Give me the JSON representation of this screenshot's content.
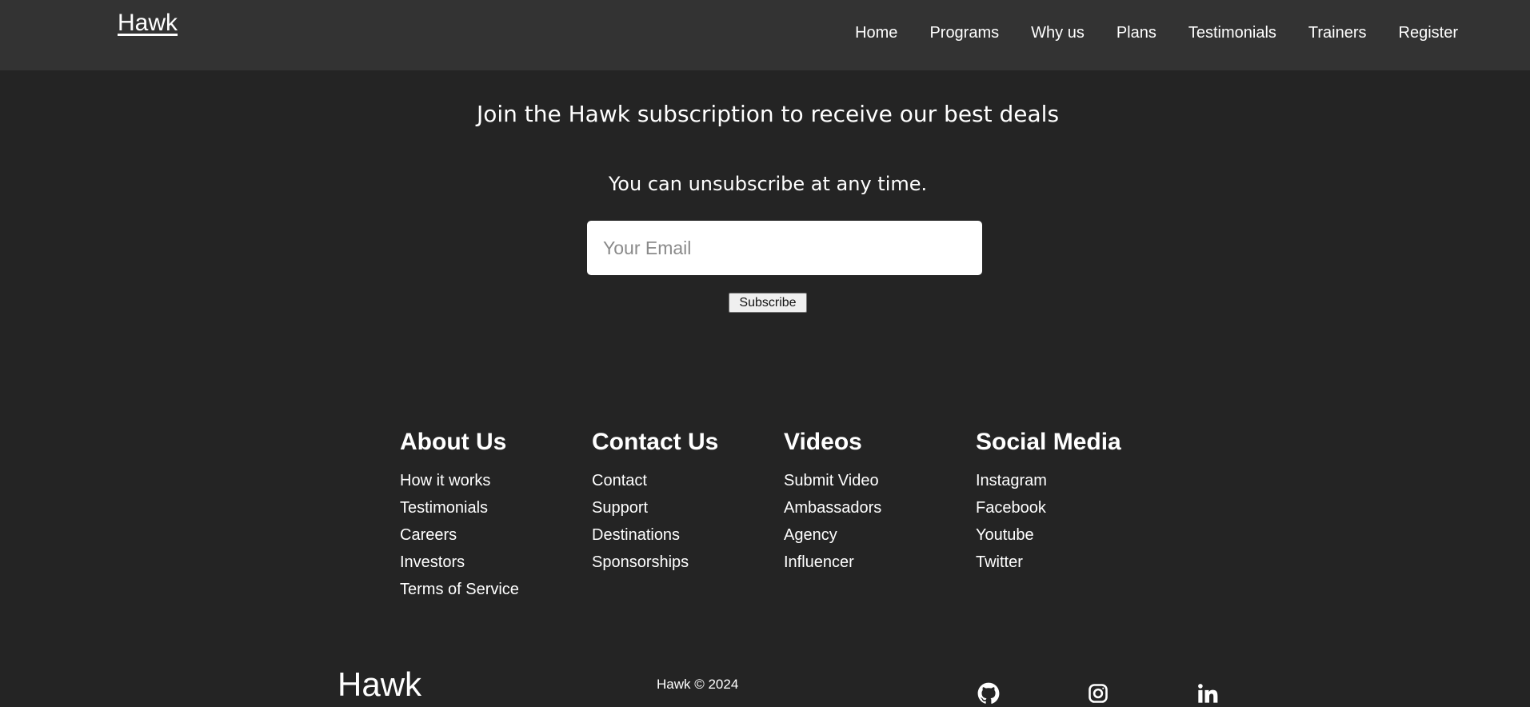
{
  "header": {
    "brand": "Hawk",
    "nav": [
      "Home",
      "Programs",
      "Why us",
      "Plans",
      "Testimonials",
      "Trainers",
      "Register"
    ]
  },
  "subscribe": {
    "heading": "Join the Hawk subscription to receive our best deals",
    "subtext": "You can unsubscribe at any time.",
    "email_placeholder": "Your Email",
    "email_value": "",
    "button_label": "Subscribe"
  },
  "footer": {
    "columns": [
      {
        "title": "About Us",
        "links": [
          "How it works",
          "Testimonials",
          "Careers",
          "Investors",
          "Terms of Service"
        ]
      },
      {
        "title": "Contact Us",
        "links": [
          "Contact",
          "Support",
          "Destinations",
          "Sponsorships"
        ]
      },
      {
        "title": "Videos",
        "links": [
          "Submit Video",
          "Ambassadors",
          "Agency",
          "Influencer"
        ]
      },
      {
        "title": "Social Media",
        "links": [
          "Instagram",
          "Facebook",
          "Youtube",
          "Twitter"
        ]
      }
    ],
    "logo": "Hawk",
    "copyright": "Hawk © 2024",
    "social_icons": [
      "github-icon",
      "instagram-icon",
      "linkedin-icon"
    ]
  },
  "colors": {
    "background": "#242424",
    "navbar": "#333333",
    "text": "#ffffff"
  }
}
